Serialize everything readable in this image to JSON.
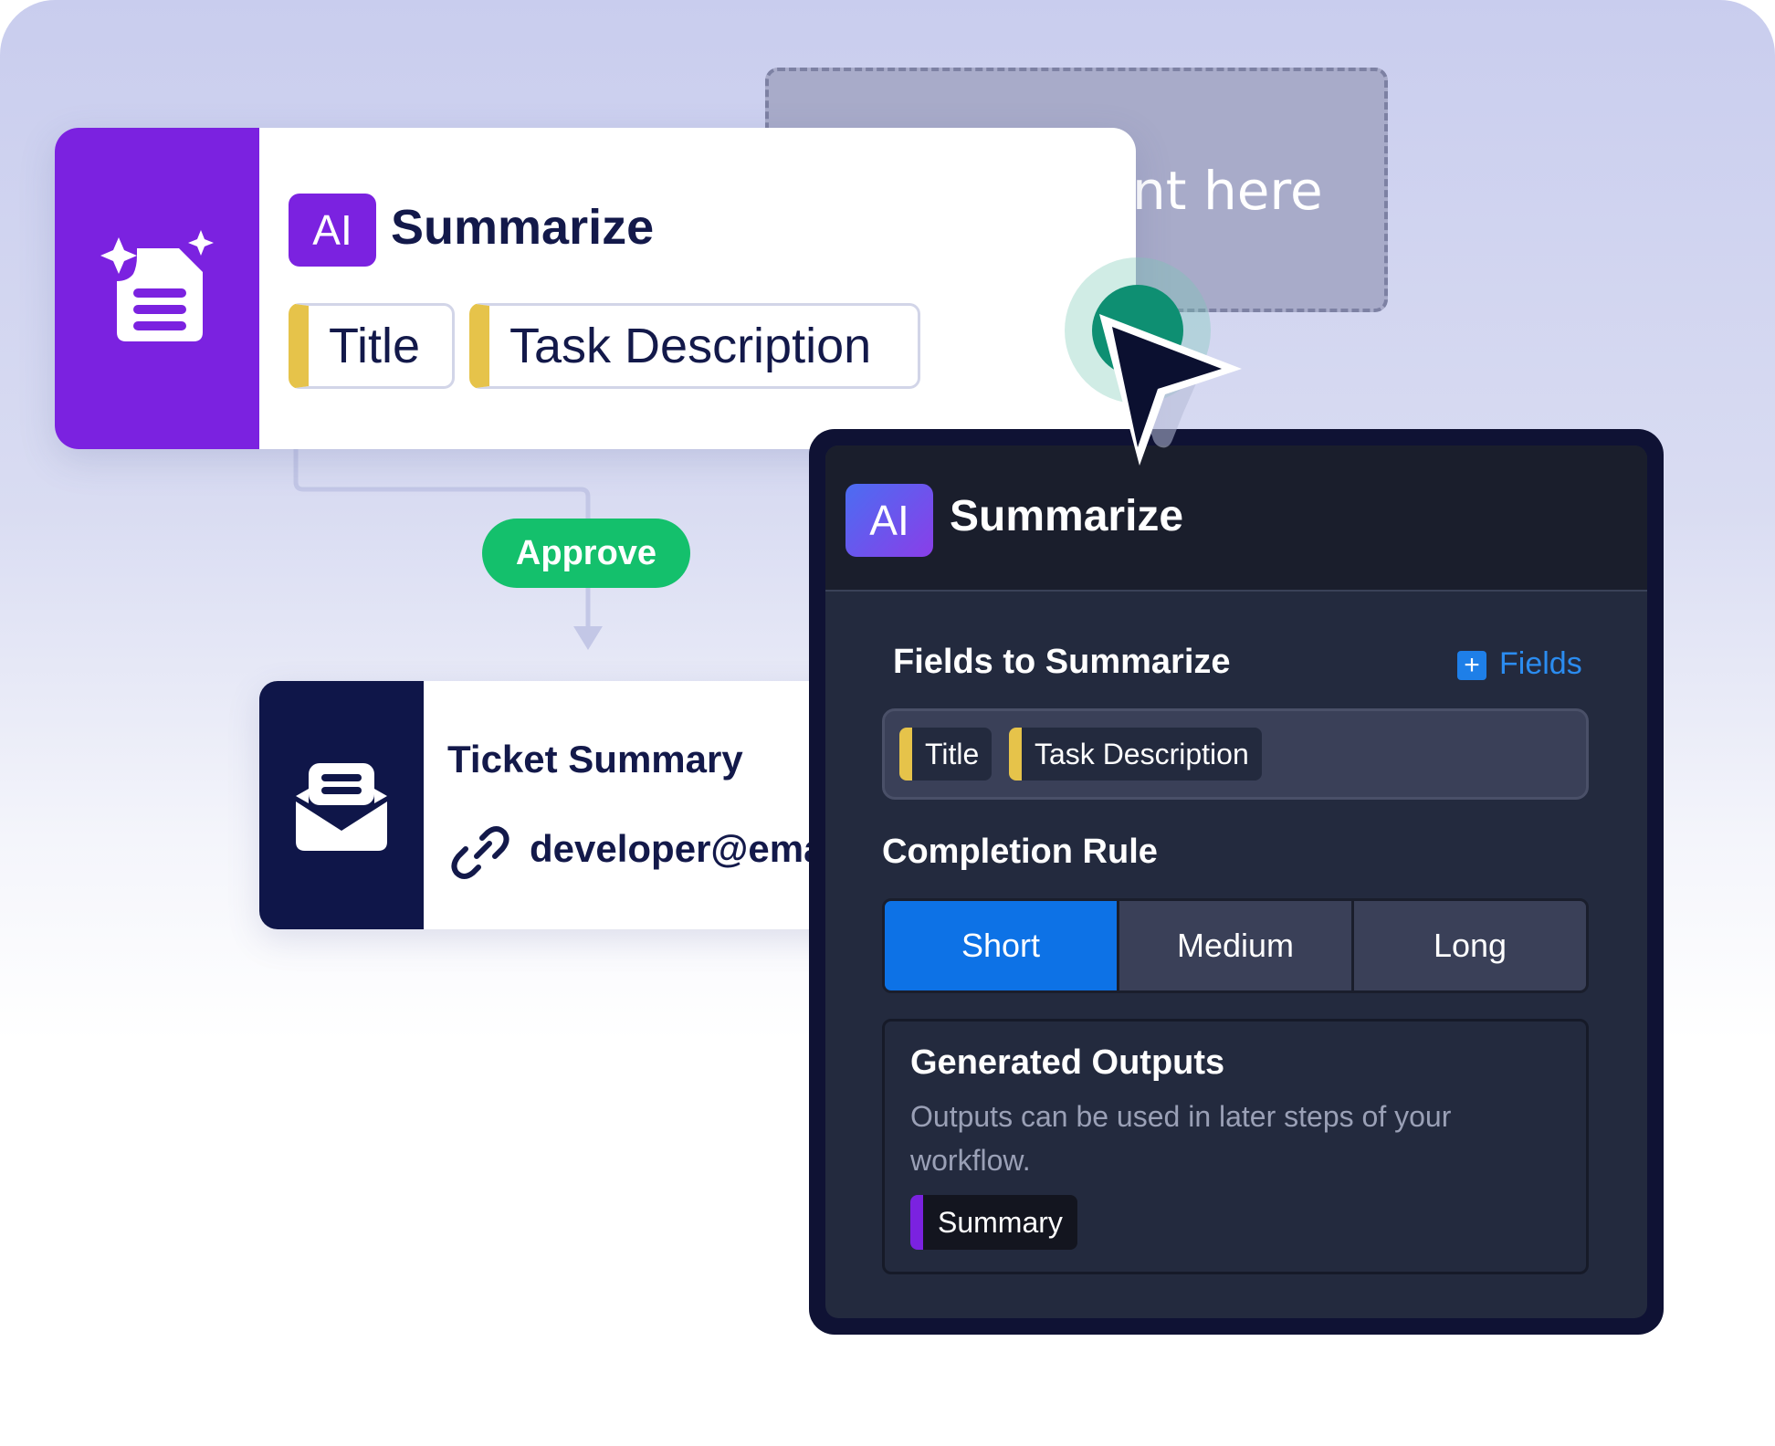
{
  "dropzone": {
    "text": "nt here"
  },
  "ai_node": {
    "badge": "AI",
    "title": "Summarize",
    "fields": [
      "Title",
      "Task Description"
    ]
  },
  "approve": {
    "label": "Approve"
  },
  "ticket_node": {
    "title": "Ticket Summary",
    "email": "developer@ema"
  },
  "panel": {
    "badge": "AI",
    "title": "Summarize",
    "fields_section": {
      "label": "Fields to Summarize",
      "add_label": "Fields",
      "fields": [
        "Title",
        "Task Description"
      ]
    },
    "completion": {
      "label": "Completion Rule",
      "options": [
        "Short",
        "Medium",
        "Long"
      ],
      "selected": "Short"
    },
    "outputs": {
      "title": "Generated Outputs",
      "description": "Outputs can be used in later steps of your workflow.",
      "chip": "Summary"
    }
  },
  "colors": {
    "purple": "#7b22e0",
    "navy": "#0f1649",
    "green": "#14c06c",
    "blue_active": "#0d72e6",
    "field_yellow": "#e6c34a"
  },
  "icons": {
    "ai_node": "ai-document-sparkle-icon",
    "ticket_node": "open-envelope-icon",
    "email": "link-icon",
    "add": "plus-square-icon",
    "cursor": "mouse-pointer-icon"
  }
}
